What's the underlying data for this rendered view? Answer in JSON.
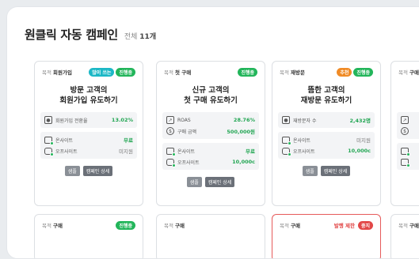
{
  "header": {
    "title": "원클릭 자동 캠페인",
    "total_label": "전체",
    "total_count": "11개"
  },
  "purpose_label": "목적",
  "buttons": {
    "sample": "샘플",
    "detail": "캠페인 상세"
  },
  "cards": [
    {
      "purpose": "회원가입",
      "badges": [
        {
          "text": "많이 쓰는",
          "color": "#1cb8c6"
        },
        {
          "text": "진행중",
          "color": "#22b55a"
        }
      ],
      "headline": [
        "방문 고객의",
        "회원가입 유도하기"
      ],
      "metrics": [
        {
          "label": "회원가입 전환율",
          "value": "13.02%",
          "icon": "user-icon"
        }
      ],
      "sites": [
        {
          "label": "온사이트",
          "value": "무료",
          "on": true
        },
        {
          "label": "오프사이트",
          "value": "미지원",
          "on": false
        }
      ]
    },
    {
      "purpose": "첫 구매",
      "badges": [
        {
          "text": "진행중",
          "color": "#22b55a"
        }
      ],
      "headline": [
        "신규 고객의",
        "첫 구매 유도하기"
      ],
      "metrics": [
        {
          "label": "ROAS",
          "value": "28.76%",
          "icon": "trend-icon"
        },
        {
          "label": "구매 금액",
          "value": "500,000원",
          "icon": "coin-icon"
        }
      ],
      "sites": [
        {
          "label": "온사이트",
          "value": "무료",
          "on": true
        },
        {
          "label": "오프사이트",
          "value": "10,000c",
          "on": true
        }
      ]
    },
    {
      "purpose": "재방문",
      "badges": [
        {
          "text": "추천",
          "color": "#f08b26"
        },
        {
          "text": "진행중",
          "color": "#22b55a"
        }
      ],
      "headline": [
        "뜸한 고객의",
        "재방문 유도하기"
      ],
      "metrics": [
        {
          "label": "재방문자 수",
          "value": "2,432명",
          "icon": "user-icon"
        }
      ],
      "sites": [
        {
          "label": "온사이트",
          "value": "미지원",
          "on": false
        },
        {
          "label": "오프사이트",
          "value": "10,000c",
          "on": true
        }
      ]
    },
    {
      "purpose": "구매",
      "badges": [],
      "headline": [
        "",
        ""
      ],
      "metrics": [],
      "sites": []
    }
  ],
  "bottom_cards": [
    {
      "purpose": "구매",
      "badge": "진행중",
      "badge_color": "#22b55a"
    },
    {
      "purpose": "구매"
    },
    {
      "purpose": "구매",
      "block_text": "발행 제한",
      "badge": "중지",
      "badge_color": "#e24848"
    },
    {
      "purpose": "구매"
    }
  ]
}
